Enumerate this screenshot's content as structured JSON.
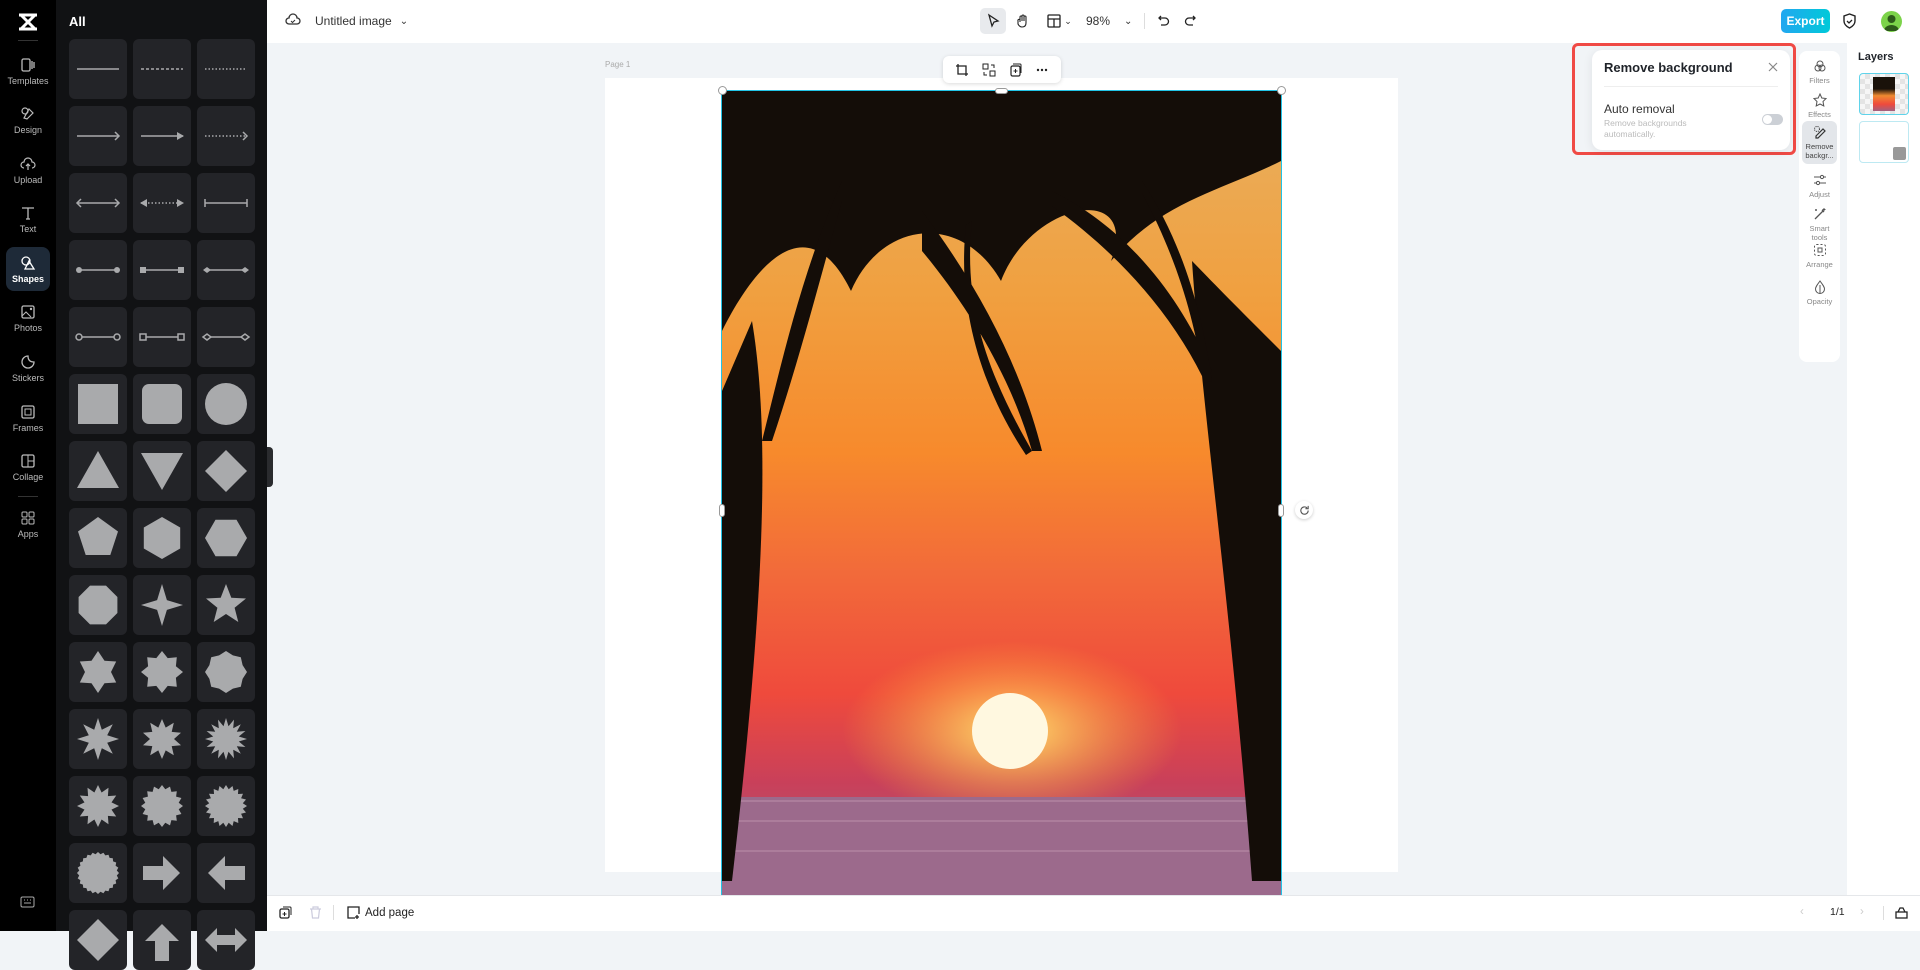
{
  "rail": {
    "items": [
      {
        "label": "Templates",
        "icon": "templates-icon"
      },
      {
        "label": "Design",
        "icon": "design-icon"
      },
      {
        "label": "Upload",
        "icon": "upload-icon"
      },
      {
        "label": "Text",
        "icon": "text-icon"
      },
      {
        "label": "Shapes",
        "icon": "shapes-icon",
        "active": true
      },
      {
        "label": "Photos",
        "icon": "photos-icon"
      },
      {
        "label": "Stickers",
        "icon": "stickers-icon"
      },
      {
        "label": "Frames",
        "icon": "frames-icon"
      },
      {
        "label": "Collage",
        "icon": "collage-icon"
      },
      {
        "label": "Apps",
        "icon": "apps-icon"
      }
    ]
  },
  "panel": {
    "title": "All",
    "shapes": [
      "line-solid",
      "line-dashed",
      "line-dotted",
      "arrow-open",
      "arrow-filled",
      "arrow-dotted",
      "double-arrow-open",
      "double-arrow-dotted",
      "line-bar-ends",
      "line-dot-ends",
      "line-square-ends",
      "line-diamond-ends",
      "line-hollow-circle-ends",
      "line-hollow-square-ends",
      "line-hollow-diamond-ends",
      "square",
      "rounded-square",
      "circle",
      "triangle",
      "inverted-triangle",
      "diamond",
      "pentagon",
      "hexagon",
      "hexagon-flat",
      "octagon",
      "star-4",
      "star-5",
      "star-6",
      "star-8",
      "star-8-round",
      "burst-8",
      "burst-10",
      "burst-16",
      "burst-12",
      "burst-16-round",
      "burst-20",
      "seal-24",
      "arrow-right",
      "arrow-left",
      "diamond-partial",
      "arrow-up-partial",
      "double-arrow-partial"
    ]
  },
  "topbar": {
    "doc_title": "Untitled image",
    "zoom": "98%",
    "export_label": "Export"
  },
  "canvas": {
    "page_label": "Page 1"
  },
  "popup": {
    "title": "Remove background",
    "option_label": "Auto removal",
    "option_desc": "Remove backgrounds automatically.",
    "toggle_on": false
  },
  "strip": {
    "items": [
      {
        "label": "Filters"
      },
      {
        "label": "Effects"
      },
      {
        "label": "Remove backgr...",
        "active": true
      },
      {
        "label": "Adjust"
      },
      {
        "label": "Smart tools"
      },
      {
        "label": "Arrange"
      },
      {
        "label": "Opacity"
      }
    ]
  },
  "layers": {
    "title": "Layers"
  },
  "bottombar": {
    "add_page": "Add page",
    "page_count": "1/1"
  },
  "colors": {
    "accent": "#22c3e6",
    "highlight": "#f04a45",
    "export_start": "#22a7f0",
    "export_end": "#00c9d9"
  }
}
